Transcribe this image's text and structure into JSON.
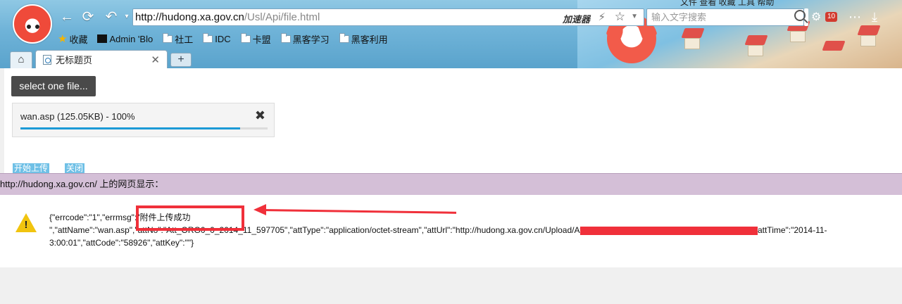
{
  "browser": {
    "url_host": "http://hudong.xa.gov.cn",
    "url_path": "/Usl/Api/file.html",
    "accelerator_label": "加速器",
    "search_placeholder": "输入文字搜索",
    "badge_count": "10",
    "menu_top": "文件   查看   收藏   工具   帮助",
    "bookmarks": [
      {
        "label": "收藏",
        "icon": "star-icon"
      },
      {
        "label": "Admin  'Blo",
        "icon": "admin-icon"
      },
      {
        "label": "社工",
        "icon": "folder-icon"
      },
      {
        "label": "IDC",
        "icon": "folder-icon"
      },
      {
        "label": "卡盟",
        "icon": "folder-icon"
      },
      {
        "label": "黑客学习",
        "icon": "folder-icon"
      },
      {
        "label": "黑客利用",
        "icon": "folder-icon"
      }
    ],
    "tab_title": "无标题页"
  },
  "page": {
    "select_button": "select one file...",
    "file_item": "wan.asp (125.05KB) - 100%",
    "progress_percent": 100,
    "upload_link": "开始上传",
    "close_link": "关闭"
  },
  "dialog": {
    "title": "http://hudong.xa.gov.cn/ 上的网页显示：",
    "line1": "{\"errcode\":\"1\",\"errmsg\":\"附件上传成功",
    "line2": "\",\"attName\":\"wan.asp\",\"attNo\":\"Att_ORG0_0_2014_11_597705\",\"attType\":\"application/octet-stream\",\"attUrl\":\"http://hudong.xa.gov.cn/Upload/Att/Att_ORG0_0_2014_11_597705_58926.asp\",\"attTime\":\"2014-11-",
    "line3": "3:00:01\",\"attCode\":\"58926\",\"attKey\":\"\"}"
  },
  "colors": {
    "annotation_red": "#f0303a",
    "progress_blue": "#1b9ad6",
    "dialog_title_bg": "#d4bfd7"
  }
}
